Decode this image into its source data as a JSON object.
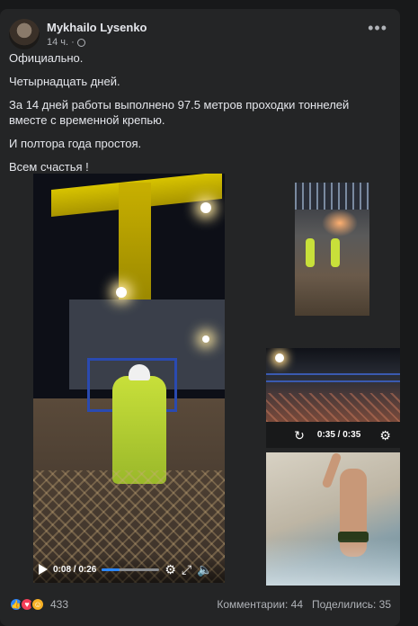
{
  "post": {
    "author": "Mykhailo Lysenko",
    "time": "14 ч.",
    "privacy_icon": "globe-icon",
    "more_icon": "more-horizontal-icon",
    "paragraphs": [
      "Официально.",
      "Четырнадцать дней.",
      "За 14 дней работы выполнено 97.5 метров проходки тоннелей вместе с временной крепью.",
      "И полтора года простоя.",
      "Всем счастья !"
    ]
  },
  "video_main": {
    "time": "0:08 / 0:26",
    "progress_fraction": 0.31,
    "icons": [
      "play-icon",
      "settings-icon",
      "fullscreen-icon",
      "volume-icon"
    ]
  },
  "video_thumb": {
    "time": "0:35 / 0:35",
    "icons": [
      "replay-icon",
      "settings-icon"
    ]
  },
  "reactions": {
    "icons": [
      "like-icon",
      "love-icon",
      "haha-icon"
    ],
    "count": "433",
    "comments": "Комментарии: 44",
    "shares": "Поделились: 35"
  }
}
